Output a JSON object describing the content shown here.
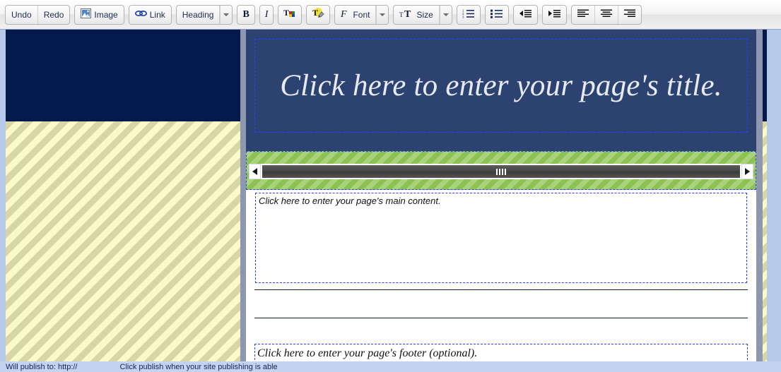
{
  "toolbar": {
    "groups": [
      {
        "name": "history",
        "buttons": [
          {
            "label": "Undo",
            "icon": "undo-icon"
          },
          {
            "label": "Redo",
            "icon": "redo-icon"
          }
        ]
      },
      {
        "name": "insert-image",
        "buttons": [
          {
            "label": "Image",
            "icon": "image-icon"
          }
        ]
      },
      {
        "name": "insert-link",
        "buttons": [
          {
            "label": "Link",
            "icon": "link-icon"
          }
        ]
      },
      {
        "name": "heading-style",
        "buttons": [
          {
            "label": "Heading",
            "icon": "heading-icon",
            "has_caret": true
          }
        ]
      },
      {
        "name": "text-style",
        "buttons": [
          {
            "label": "B",
            "icon": "bold-icon"
          },
          {
            "label": "I",
            "icon": "italic-icon"
          }
        ]
      },
      {
        "name": "text-color",
        "buttons": [
          {
            "label": "",
            "icon": "text-color-icon"
          }
        ]
      },
      {
        "name": "highlight-color",
        "buttons": [
          {
            "label": "",
            "icon": "highlight-color-icon"
          }
        ]
      },
      {
        "name": "font-family",
        "buttons": [
          {
            "label": "Font",
            "icon": "font-icon",
            "has_caret": true
          }
        ]
      },
      {
        "name": "font-size",
        "buttons": [
          {
            "label": "Size",
            "icon": "size-icon",
            "has_caret": true
          }
        ]
      },
      {
        "name": "lists",
        "buttons": [
          {
            "label": "",
            "icon": "numbered-list-icon"
          }
        ]
      },
      {
        "name": "bullets",
        "buttons": [
          {
            "label": "",
            "icon": "bullet-list-icon"
          }
        ]
      },
      {
        "name": "outdent",
        "buttons": [
          {
            "label": "",
            "icon": "outdent-icon"
          }
        ]
      },
      {
        "name": "indent",
        "buttons": [
          {
            "label": "",
            "icon": "indent-icon"
          }
        ]
      },
      {
        "name": "alignment",
        "buttons": [
          {
            "label": "",
            "icon": "align-left-icon"
          },
          {
            "label": "",
            "icon": "align-center-icon"
          },
          {
            "label": "",
            "icon": "align-right-icon"
          }
        ]
      }
    ],
    "labels": {
      "undo": "Undo",
      "redo": "Redo",
      "image": "Image",
      "link": "Link",
      "heading": "Heading",
      "bold": "B",
      "italic": "I",
      "font": "Font",
      "size": "Size"
    }
  },
  "page": {
    "title_placeholder": "Click here to enter your page's title.",
    "main_placeholder": "Click here to enter your page's main content.",
    "footer_placeholder": "Click here to enter your page's footer (optional)."
  },
  "status_bar": {
    "left_text": "Will publish to: http://",
    "right_text": "Click publish when your site publishing is able"
  },
  "colors": {
    "navy_band": "#041a4c",
    "title_hero": "#2c4372",
    "nav_green": "#8cc153",
    "page_stripe_light": "#fafac8",
    "page_stripe_dark": "#d6d6a8",
    "editable_outline": "#2b3fff",
    "gutter": "#b7c9e8"
  }
}
